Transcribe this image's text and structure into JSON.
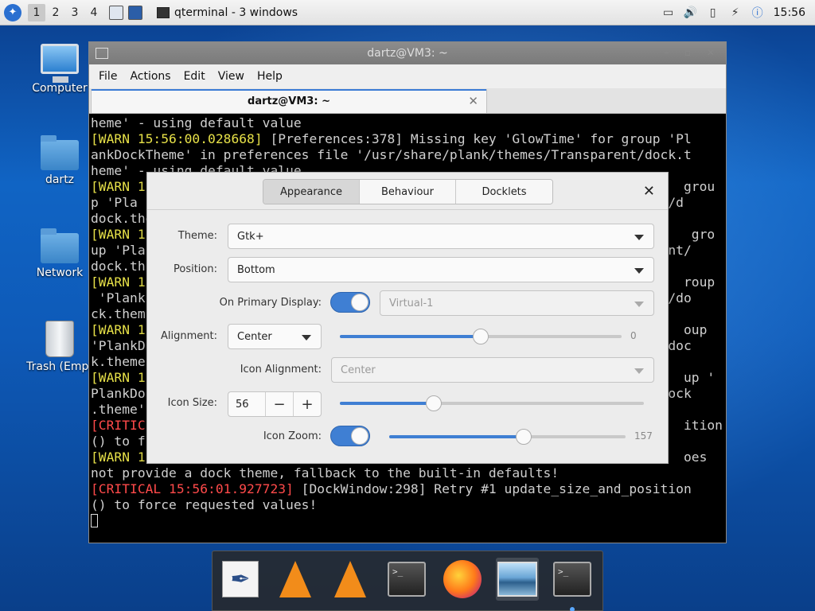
{
  "panel": {
    "workspaces": [
      "1",
      "2",
      "3",
      "4"
    ],
    "active_workspace": "1",
    "task_label": "qterminal - 3 windows",
    "clock": "15:56",
    "tray_icons": [
      "clipboard-icon",
      "volume-icon",
      "battery-icon",
      "network-icon",
      "update-icon"
    ]
  },
  "desktop": {
    "icons": [
      "Computer",
      "dartz",
      "Network",
      "Trash (Empt"
    ]
  },
  "terminal": {
    "title": "dartz@VM3: ~",
    "menu": [
      "File",
      "Actions",
      "Edit",
      "View",
      "Help"
    ],
    "tab_label": "dartz@VM3: ~",
    "lines": [
      {
        "t": "heme' - using default value",
        "c": ""
      },
      {
        "p": "[WARN 15:56:00.028668]",
        "t": " [Preferences:378] Missing key 'GlowTime' for group 'Pl",
        "c": "y"
      },
      {
        "t": "ankDockTheme' in preferences file '/usr/share/plank/themes/Transparent/dock.t",
        "c": ""
      },
      {
        "t": "heme' - using default value",
        "c": ""
      },
      {
        "p": "[WARN 1",
        "t": "                                                                     grou",
        "c": "y"
      },
      {
        "t": "p 'Pla                                                                  nt/d",
        "c": ""
      },
      {
        "t": "dock.the",
        "c": ""
      },
      {
        "p": "[WARN 1",
        "t": "                                                                      gro",
        "c": "y"
      },
      {
        "t": "up 'Pla                                                                  ent/",
        "c": ""
      },
      {
        "t": "dock.th",
        "c": ""
      },
      {
        "p": "[WARN 1",
        "t": "                                                                     roup",
        "c": "y"
      },
      {
        "t": " 'Plank                                                                  t/do",
        "c": ""
      },
      {
        "t": "ck.them",
        "c": ""
      },
      {
        "p": "[WARN 1",
        "t": "                                                                     oup",
        "c": "y"
      },
      {
        "t": "'PlankD                                                                  /doc",
        "c": ""
      },
      {
        "t": "k.theme",
        "c": ""
      },
      {
        "p": "[WARN 1",
        "t": "                                                                     up '",
        "c": "y"
      },
      {
        "t": "PlankDo                                                                  dock",
        "c": ""
      },
      {
        "t": ".theme'",
        "c": ""
      },
      {
        "p": "[CRITIC",
        "t": "                                                                     ition",
        "c": "r"
      },
      {
        "t": "() to f                                                                  ",
        "c": ""
      },
      {
        "p": "[WARN 1",
        "t": "                                                                     oes",
        "c": "y"
      },
      {
        "t": "not provide a dock theme, fallback to the built-in defaults!",
        "c": ""
      },
      {
        "p": "[CRITICAL 15:56:01.927723]",
        "t": " [DockWindow:298] Retry #1 update_size_and_position",
        "c": "r"
      },
      {
        "t": "() to force requested values!",
        "c": ""
      }
    ]
  },
  "dialog": {
    "tabs": [
      "Appearance",
      "Behaviour",
      "Docklets"
    ],
    "active_tab": "Appearance",
    "theme_label": "Theme:",
    "theme_value": "Gtk+",
    "position_label": "Position:",
    "position_value": "Bottom",
    "primary_label": "On Primary Display:",
    "primary_on": true,
    "monitor_value": "Virtual-1",
    "alignment_label": "Alignment:",
    "alignment_value": "Center",
    "offset_value": "0",
    "offset_fraction": 0.5,
    "icon_alignment_label": "Icon Alignment:",
    "icon_alignment_value": "Center",
    "icon_size_label": "Icon Size:",
    "icon_size_value": "56",
    "icon_size_fraction": 0.31,
    "icon_zoom_label": "Icon Zoom:",
    "icon_zoom_on": true,
    "icon_zoom_value": "157",
    "icon_zoom_fraction": 0.57
  },
  "dock": {
    "items": [
      "text-editor-icon",
      "vlc-icon",
      "vlc-icon",
      "terminal-icon",
      "firefox-icon",
      "image-viewer-icon",
      "terminal-icon"
    ]
  }
}
